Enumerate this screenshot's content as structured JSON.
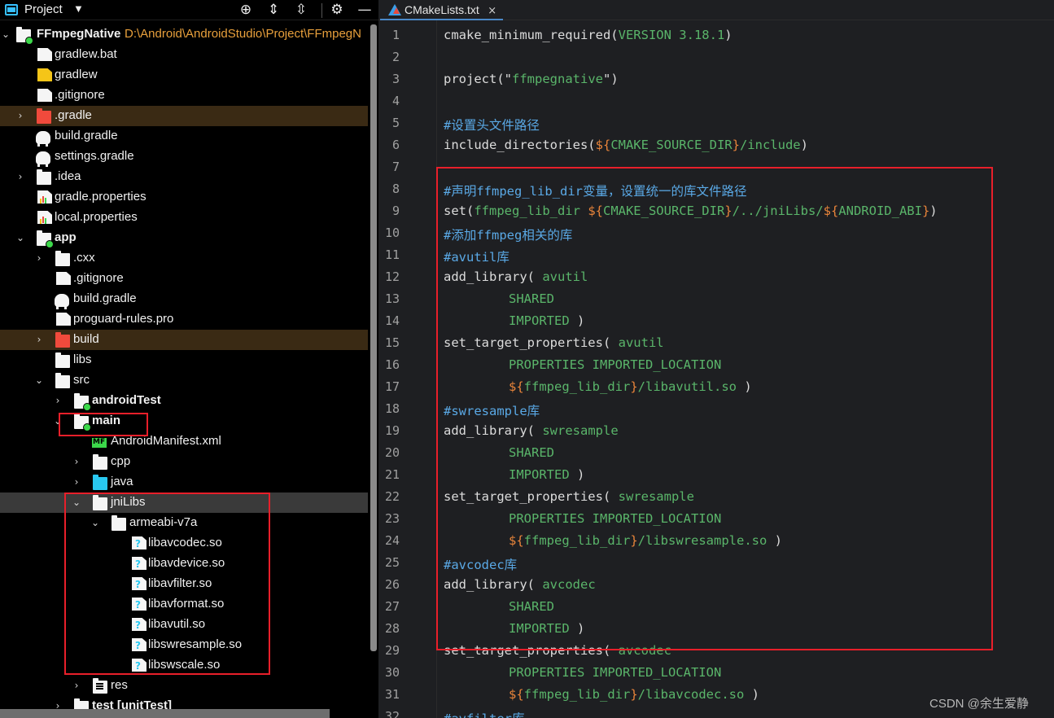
{
  "project_panel": {
    "title": "Project",
    "root": {
      "name": "FFmpegNative",
      "path": "D:\\Android\\AndroidStudio\\Project\\FFmpegN"
    },
    "items": [
      {
        "label": "gradlew.bat"
      },
      {
        "label": "gradlew"
      },
      {
        "label": ".gitignore"
      },
      {
        "label": ".gradle"
      },
      {
        "label": "build.gradle"
      },
      {
        "label": "settings.gradle"
      },
      {
        "label": ".idea"
      },
      {
        "label": "gradle.properties"
      },
      {
        "label": "local.properties"
      },
      {
        "label": "app"
      },
      {
        "label": ".cxx"
      },
      {
        "label": ".gitignore"
      },
      {
        "label": "build.gradle"
      },
      {
        "label": "proguard-rules.pro"
      },
      {
        "label": "build"
      },
      {
        "label": "libs"
      },
      {
        "label": "src"
      },
      {
        "label": "androidTest"
      },
      {
        "label": "main"
      },
      {
        "label": "AndroidManifest.xml"
      },
      {
        "label": "cpp"
      },
      {
        "label": "java"
      },
      {
        "label": "jniLibs"
      },
      {
        "label": "armeabi-v7a"
      },
      {
        "label": "libavcodec.so"
      },
      {
        "label": "libavdevice.so"
      },
      {
        "label": "libavfilter.so"
      },
      {
        "label": "libavformat.so"
      },
      {
        "label": "libavutil.so"
      },
      {
        "label": "libswresample.so"
      },
      {
        "label": "libswscale.so"
      },
      {
        "label": "res"
      },
      {
        "label": "test [unitTest]"
      }
    ]
  },
  "editor": {
    "tab_label": "CMakeLists.txt",
    "tab_close": "×",
    "line_numbers": [
      "1",
      "2",
      "3",
      "4",
      "5",
      "6",
      "7",
      "8",
      "9",
      "10",
      "11",
      "12",
      "13",
      "14",
      "15",
      "16",
      "17",
      "18",
      "19",
      "20",
      "21",
      "22",
      "23",
      "24",
      "25",
      "26",
      "27",
      "28",
      "29",
      "30",
      "31",
      "32"
    ]
  },
  "code": {
    "l1": [
      "cmake_minimum_required(",
      "VERSION 3.18.1",
      ")"
    ],
    "l3": [
      "project(\"",
      "ffmpegnative",
      "\")"
    ],
    "l5": "#设置头文件路径",
    "l6": [
      "include_directories(",
      "${",
      "CMAKE_SOURCE_DIR",
      "}",
      "/include",
      ")"
    ],
    "l8": "#声明ffmpeg_lib_dir变量，设置统一的库文件路径",
    "l9": [
      "set(",
      "ffmpeg_lib_dir ",
      "${",
      "CMAKE_SOURCE_DIR",
      "}",
      "/../jniLibs/",
      "${",
      "ANDROID_ABI",
      "}",
      ")"
    ],
    "l10": "#添加ffmpeg相关的库",
    "l11": "#avutil库",
    "l12": [
      "add_library( ",
      "avutil"
    ],
    "l13": "SHARED",
    "l14": [
      "IMPORTED",
      " )"
    ],
    "l15": [
      "set_target_properties( ",
      "avutil"
    ],
    "l16": "PROPERTIES IMPORTED_LOCATION",
    "l17": [
      "${",
      "ffmpeg_lib_dir",
      "}",
      "/libavutil.so",
      " )"
    ],
    "l18": "#swresample库",
    "l19": [
      "add_library( ",
      "swresample"
    ],
    "l20": "SHARED",
    "l21": [
      "IMPORTED",
      " )"
    ],
    "l22": [
      "set_target_properties( ",
      "swresample"
    ],
    "l23": "PROPERTIES IMPORTED_LOCATION",
    "l24": [
      "${",
      "ffmpeg_lib_dir",
      "}",
      "/libswresample.so",
      " )"
    ],
    "l25": "#avcodec库",
    "l26": [
      "add_library( ",
      "avcodec"
    ],
    "l27": "SHARED",
    "l28": [
      "IMPORTED",
      " )"
    ],
    "l29": [
      "set_target_properties( ",
      "avcodec"
    ],
    "l30": "PROPERTIES IMPORTED_LOCATION",
    "l31": [
      "${",
      "ffmpeg_lib_dir",
      "}",
      "/libavcodec.so",
      " )"
    ],
    "l32": "#avfilter库"
  },
  "watermark": "CSDN @余生爱静",
  "colors": {
    "highlight_box": "#e81f2a",
    "code_keyword_green": "#5ab56a",
    "code_variable_orange": "#e8843a",
    "comment_blue": "#5aa9e6",
    "folder_red": "#f04a3c",
    "folder_cyan": "#29c8f0"
  }
}
